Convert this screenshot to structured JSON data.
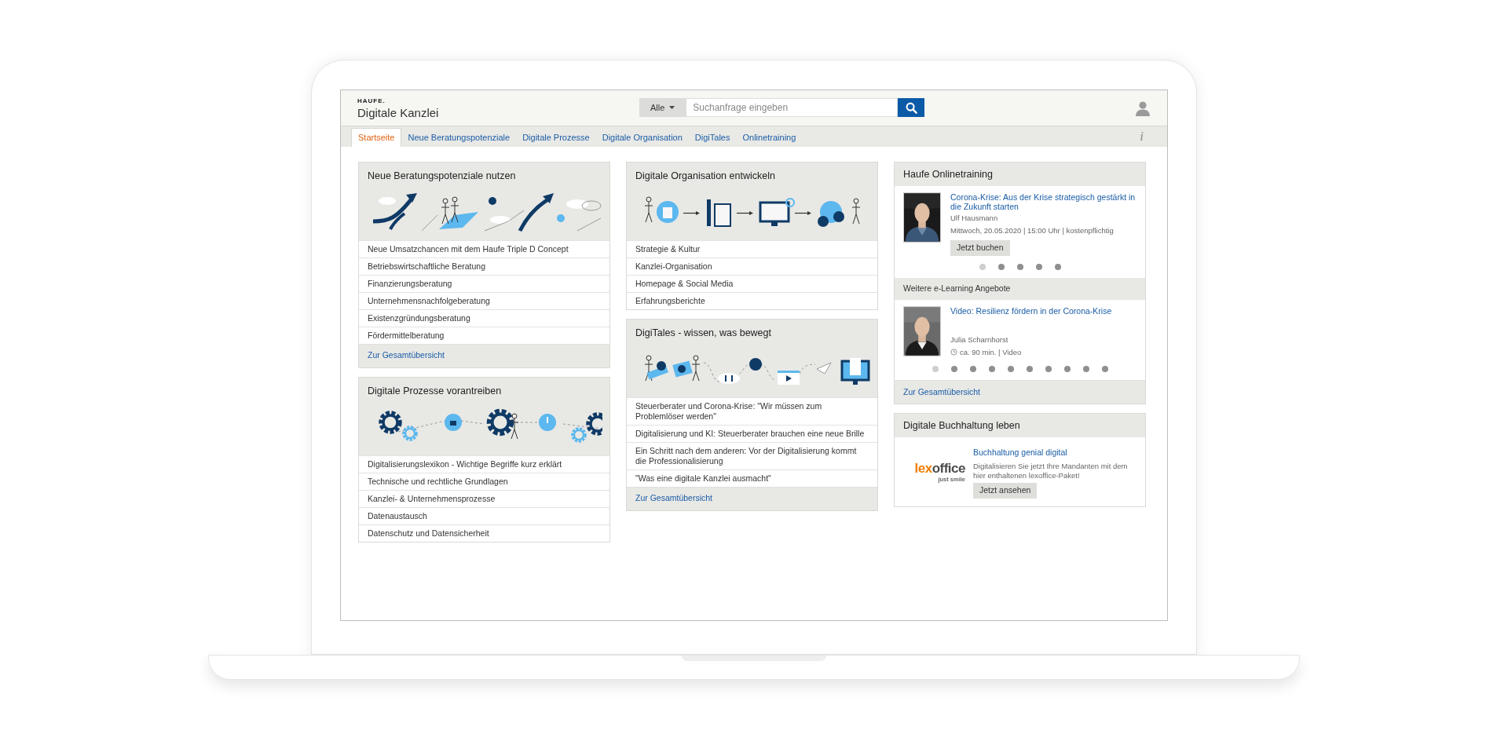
{
  "header": {
    "brand": "HAUFE.",
    "app_title": "Digitale Kanzlei",
    "search": {
      "scope": "Alle",
      "placeholder": "Suchanfrage eingeben"
    }
  },
  "nav": {
    "tabs": [
      {
        "label": "Startseite",
        "selected": true
      },
      {
        "label": "Neue Beratungspotenziale",
        "selected": false
      },
      {
        "label": "Digitale Prozesse",
        "selected": false
      },
      {
        "label": "Digitale Organisation",
        "selected": false
      },
      {
        "label": "DigiTales",
        "selected": false
      },
      {
        "label": "Onlinetraining",
        "selected": false
      }
    ],
    "info": "i"
  },
  "columns": [
    [
      {
        "kind": "links",
        "title": "Neue Beratungspotenziale nutzen",
        "illustration": {
          "kind": "growth"
        },
        "items": [
          "Neue Umsatzchancen mit dem Haufe Triple D Concept",
          "Betriebswirtschaftliche Beratung",
          "Finanzierungsberatung",
          "Unternehmensnachfolgeberatung",
          "Existenzgründungsberatung",
          "Fördermittelberatung"
        ],
        "footer_link": "Zur Gesamtübersicht"
      },
      {
        "kind": "links",
        "title": "Digitale Prozesse vorantreiben",
        "illustration": {
          "kind": "gears"
        },
        "items": [
          "Digitalisierungslexikon - Wichtige Begriffe kurz erklärt",
          "Technische und rechtliche Grundlagen",
          "Kanzlei- & Unternehmensprozesse",
          "Datenaustausch",
          "Datenschutz und Datensicherheit"
        ]
      }
    ],
    [
      {
        "kind": "links",
        "title": "Digitale Organisation entwickeln",
        "illustration": {
          "kind": "organisation"
        },
        "items": [
          "Strategie & Kultur",
          "Kanzlei-Organisation",
          "Homepage & Social Media",
          "Erfahrungsberichte"
        ]
      },
      {
        "kind": "links",
        "title": "DigiTales - wissen, was bewegt",
        "illustration": {
          "kind": "media"
        },
        "items": [
          "Steuerberater und Corona-Krise: \"Wir müssen zum Problemlöser werden\"",
          "Digitalisierung und KI: Steuerberater brauchen eine neue Brille",
          "Ein Schritt nach dem anderen: Vor der Digitalisierung kommt die Professionalisierung",
          "\"Was eine digitale Kanzlei ausmacht\""
        ],
        "footer_link": "Zur Gesamtübersicht"
      }
    ],
    [
      {
        "kind": "training",
        "title": "Haufe Onlinetraining",
        "sections": [
          {
            "item": {
              "title": "Corona-Krise: Aus der Krise strategisch gestärkt in die Zukunft starten",
              "speaker": "Ulf Hausmann",
              "meta": "Mittwoch, 20.05.2020 | 15:00 Uhr | kostenpflichtig",
              "clock": false,
              "button": "Jetzt buchen"
            },
            "dots": [
              {
                "selected": true
              },
              {
                "selected": false
              },
              {
                "selected": false
              },
              {
                "selected": false
              },
              {
                "selected": false
              }
            ]
          },
          {
            "subtitle": "Weitere e-Learning Angebote",
            "item": {
              "title": "Video: Resilienz fördern in der Corona-Krise",
              "speaker": "Julia Scharnhorst",
              "meta": "ca. 90 min. | Video",
              "clock": true
            },
            "dots": [
              {
                "selected": true
              },
              {
                "selected": false
              },
              {
                "selected": false
              },
              {
                "selected": false
              },
              {
                "selected": false
              },
              {
                "selected": false
              },
              {
                "selected": false
              },
              {
                "selected": false
              },
              {
                "selected": false
              },
              {
                "selected": false
              }
            ]
          }
        ],
        "footer_link": "Zur Gesamtübersicht"
      },
      {
        "kind": "promo",
        "title": "Digitale Buchhaltung leben",
        "logo": {
          "parts": [
            "lex",
            "office"
          ],
          "tagline": "just smile"
        },
        "link": "Buchhaltung genial digital",
        "text": "Digitalisieren Sie jetzt Ihre Mandanten mit dem hier enthaltenen lexoffice-Paket!",
        "button": "Jetzt ansehen"
      }
    ]
  ]
}
